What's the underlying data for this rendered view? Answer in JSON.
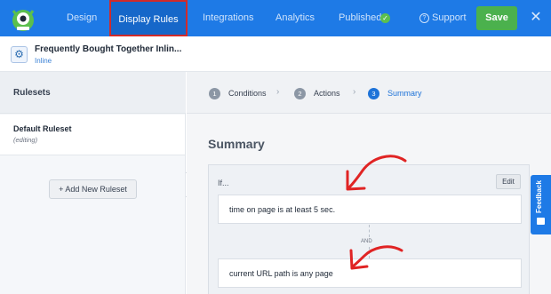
{
  "topnav": {
    "logo": "monster-logo",
    "items": [
      "Design",
      "Display Rules",
      "Integrations",
      "Analytics",
      "Published"
    ],
    "support": "Support",
    "save": "Save",
    "close": "✕"
  },
  "campaign": {
    "title": "Frequently Bought Together Inlin...",
    "type": "Inline"
  },
  "sidebar": {
    "heading": "Rulesets",
    "ruleset_name": "Default Ruleset",
    "ruleset_status": "(editing)",
    "add_button": "+ Add New Ruleset"
  },
  "steps": [
    {
      "num": "1",
      "label": "Conditions"
    },
    {
      "num": "2",
      "label": "Actions"
    },
    {
      "num": "3",
      "label": "Summary"
    }
  ],
  "summary": {
    "title": "Summary",
    "if_label": "If...",
    "edit": "Edit",
    "conditions": [
      "time on page is at least 5 sec.",
      "current URL path is any page"
    ],
    "and": "AND"
  },
  "feedback": "Feedback",
  "colors": {
    "accent": "#1e7ae6",
    "save": "#4bb14d",
    "highlight": "#d12a2a"
  }
}
